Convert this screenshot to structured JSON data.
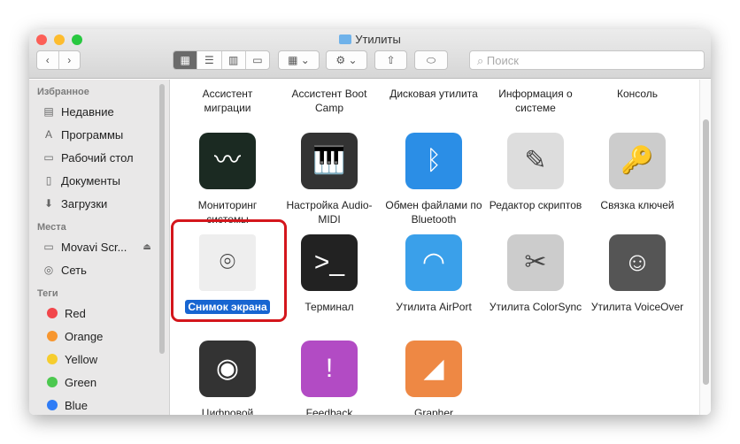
{
  "window": {
    "title": "Утилиты"
  },
  "toolbar": {
    "search_placeholder": "Поиск"
  },
  "sidebar": {
    "favorites_header": "Избранное",
    "favorites": [
      {
        "label": "Недавние",
        "icon": "recents-icon"
      },
      {
        "label": "Программы",
        "icon": "applications-icon"
      },
      {
        "label": "Рабочий стол",
        "icon": "desktop-icon"
      },
      {
        "label": "Документы",
        "icon": "documents-icon"
      },
      {
        "label": "Загрузки",
        "icon": "downloads-icon"
      }
    ],
    "places_header": "Места",
    "places": [
      {
        "label": "Movavi Scr...",
        "icon": "disk-icon"
      },
      {
        "label": "Сеть",
        "icon": "network-icon"
      }
    ],
    "tags_header": "Теги",
    "tags": [
      {
        "label": "Red",
        "color": "#f2464b"
      },
      {
        "label": "Orange",
        "color": "#f7962f"
      },
      {
        "label": "Yellow",
        "color": "#f6cd2e"
      },
      {
        "label": "Green",
        "color": "#4cc84f"
      },
      {
        "label": "Blue",
        "color": "#2f7cf6"
      }
    ]
  },
  "items": [
    {
      "label": "Ассистент миграции"
    },
    {
      "label": "Ассистент Boot Camp"
    },
    {
      "label": "Дисковая утилита"
    },
    {
      "label": "Информация о системе"
    },
    {
      "label": "Консоль"
    },
    {
      "label": "Мониторинг системы"
    },
    {
      "label": "Настройка Audio-MIDI"
    },
    {
      "label": "Обмен файлами по Bluetooth"
    },
    {
      "label": "Редактор скриптов"
    },
    {
      "label": "Связка ключей"
    },
    {
      "label": "Снимок экрана"
    },
    {
      "label": "Терминал"
    },
    {
      "label": "Утилита AirPort"
    },
    {
      "label": "Утилита ColorSync"
    },
    {
      "label": "Утилита VoiceOver"
    },
    {
      "label": "Цифровой"
    },
    {
      "label": "Feedback"
    },
    {
      "label": "Grapher"
    }
  ]
}
